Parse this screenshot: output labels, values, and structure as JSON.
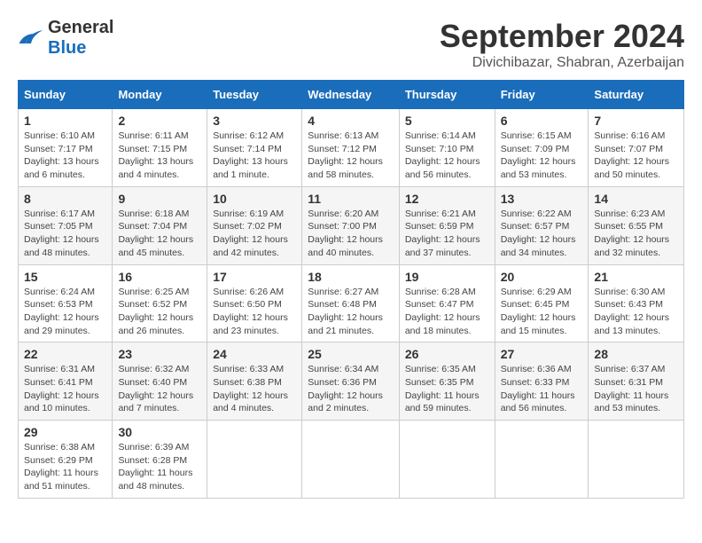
{
  "header": {
    "logo_general": "General",
    "logo_blue": "Blue",
    "month_title": "September 2024",
    "location": "Divichibazar, Shabran, Azerbaijan"
  },
  "days_of_week": [
    "Sunday",
    "Monday",
    "Tuesday",
    "Wednesday",
    "Thursday",
    "Friday",
    "Saturday"
  ],
  "weeks": [
    [
      {
        "day": "1",
        "info": "Sunrise: 6:10 AM\nSunset: 7:17 PM\nDaylight: 13 hours\nand 6 minutes."
      },
      {
        "day": "2",
        "info": "Sunrise: 6:11 AM\nSunset: 7:15 PM\nDaylight: 13 hours\nand 4 minutes."
      },
      {
        "day": "3",
        "info": "Sunrise: 6:12 AM\nSunset: 7:14 PM\nDaylight: 13 hours\nand 1 minute."
      },
      {
        "day": "4",
        "info": "Sunrise: 6:13 AM\nSunset: 7:12 PM\nDaylight: 12 hours\nand 58 minutes."
      },
      {
        "day": "5",
        "info": "Sunrise: 6:14 AM\nSunset: 7:10 PM\nDaylight: 12 hours\nand 56 minutes."
      },
      {
        "day": "6",
        "info": "Sunrise: 6:15 AM\nSunset: 7:09 PM\nDaylight: 12 hours\nand 53 minutes."
      },
      {
        "day": "7",
        "info": "Sunrise: 6:16 AM\nSunset: 7:07 PM\nDaylight: 12 hours\nand 50 minutes."
      }
    ],
    [
      {
        "day": "8",
        "info": "Sunrise: 6:17 AM\nSunset: 7:05 PM\nDaylight: 12 hours\nand 48 minutes."
      },
      {
        "day": "9",
        "info": "Sunrise: 6:18 AM\nSunset: 7:04 PM\nDaylight: 12 hours\nand 45 minutes."
      },
      {
        "day": "10",
        "info": "Sunrise: 6:19 AM\nSunset: 7:02 PM\nDaylight: 12 hours\nand 42 minutes."
      },
      {
        "day": "11",
        "info": "Sunrise: 6:20 AM\nSunset: 7:00 PM\nDaylight: 12 hours\nand 40 minutes."
      },
      {
        "day": "12",
        "info": "Sunrise: 6:21 AM\nSunset: 6:59 PM\nDaylight: 12 hours\nand 37 minutes."
      },
      {
        "day": "13",
        "info": "Sunrise: 6:22 AM\nSunset: 6:57 PM\nDaylight: 12 hours\nand 34 minutes."
      },
      {
        "day": "14",
        "info": "Sunrise: 6:23 AM\nSunset: 6:55 PM\nDaylight: 12 hours\nand 32 minutes."
      }
    ],
    [
      {
        "day": "15",
        "info": "Sunrise: 6:24 AM\nSunset: 6:53 PM\nDaylight: 12 hours\nand 29 minutes."
      },
      {
        "day": "16",
        "info": "Sunrise: 6:25 AM\nSunset: 6:52 PM\nDaylight: 12 hours\nand 26 minutes."
      },
      {
        "day": "17",
        "info": "Sunrise: 6:26 AM\nSunset: 6:50 PM\nDaylight: 12 hours\nand 23 minutes."
      },
      {
        "day": "18",
        "info": "Sunrise: 6:27 AM\nSunset: 6:48 PM\nDaylight: 12 hours\nand 21 minutes."
      },
      {
        "day": "19",
        "info": "Sunrise: 6:28 AM\nSunset: 6:47 PM\nDaylight: 12 hours\nand 18 minutes."
      },
      {
        "day": "20",
        "info": "Sunrise: 6:29 AM\nSunset: 6:45 PM\nDaylight: 12 hours\nand 15 minutes."
      },
      {
        "day": "21",
        "info": "Sunrise: 6:30 AM\nSunset: 6:43 PM\nDaylight: 12 hours\nand 13 minutes."
      }
    ],
    [
      {
        "day": "22",
        "info": "Sunrise: 6:31 AM\nSunset: 6:41 PM\nDaylight: 12 hours\nand 10 minutes."
      },
      {
        "day": "23",
        "info": "Sunrise: 6:32 AM\nSunset: 6:40 PM\nDaylight: 12 hours\nand 7 minutes."
      },
      {
        "day": "24",
        "info": "Sunrise: 6:33 AM\nSunset: 6:38 PM\nDaylight: 12 hours\nand 4 minutes."
      },
      {
        "day": "25",
        "info": "Sunrise: 6:34 AM\nSunset: 6:36 PM\nDaylight: 12 hours\nand 2 minutes."
      },
      {
        "day": "26",
        "info": "Sunrise: 6:35 AM\nSunset: 6:35 PM\nDaylight: 11 hours\nand 59 minutes."
      },
      {
        "day": "27",
        "info": "Sunrise: 6:36 AM\nSunset: 6:33 PM\nDaylight: 11 hours\nand 56 minutes."
      },
      {
        "day": "28",
        "info": "Sunrise: 6:37 AM\nSunset: 6:31 PM\nDaylight: 11 hours\nand 53 minutes."
      }
    ],
    [
      {
        "day": "29",
        "info": "Sunrise: 6:38 AM\nSunset: 6:29 PM\nDaylight: 11 hours\nand 51 minutes."
      },
      {
        "day": "30",
        "info": "Sunrise: 6:39 AM\nSunset: 6:28 PM\nDaylight: 11 hours\nand 48 minutes."
      },
      {
        "day": "",
        "info": ""
      },
      {
        "day": "",
        "info": ""
      },
      {
        "day": "",
        "info": ""
      },
      {
        "day": "",
        "info": ""
      },
      {
        "day": "",
        "info": ""
      }
    ]
  ]
}
